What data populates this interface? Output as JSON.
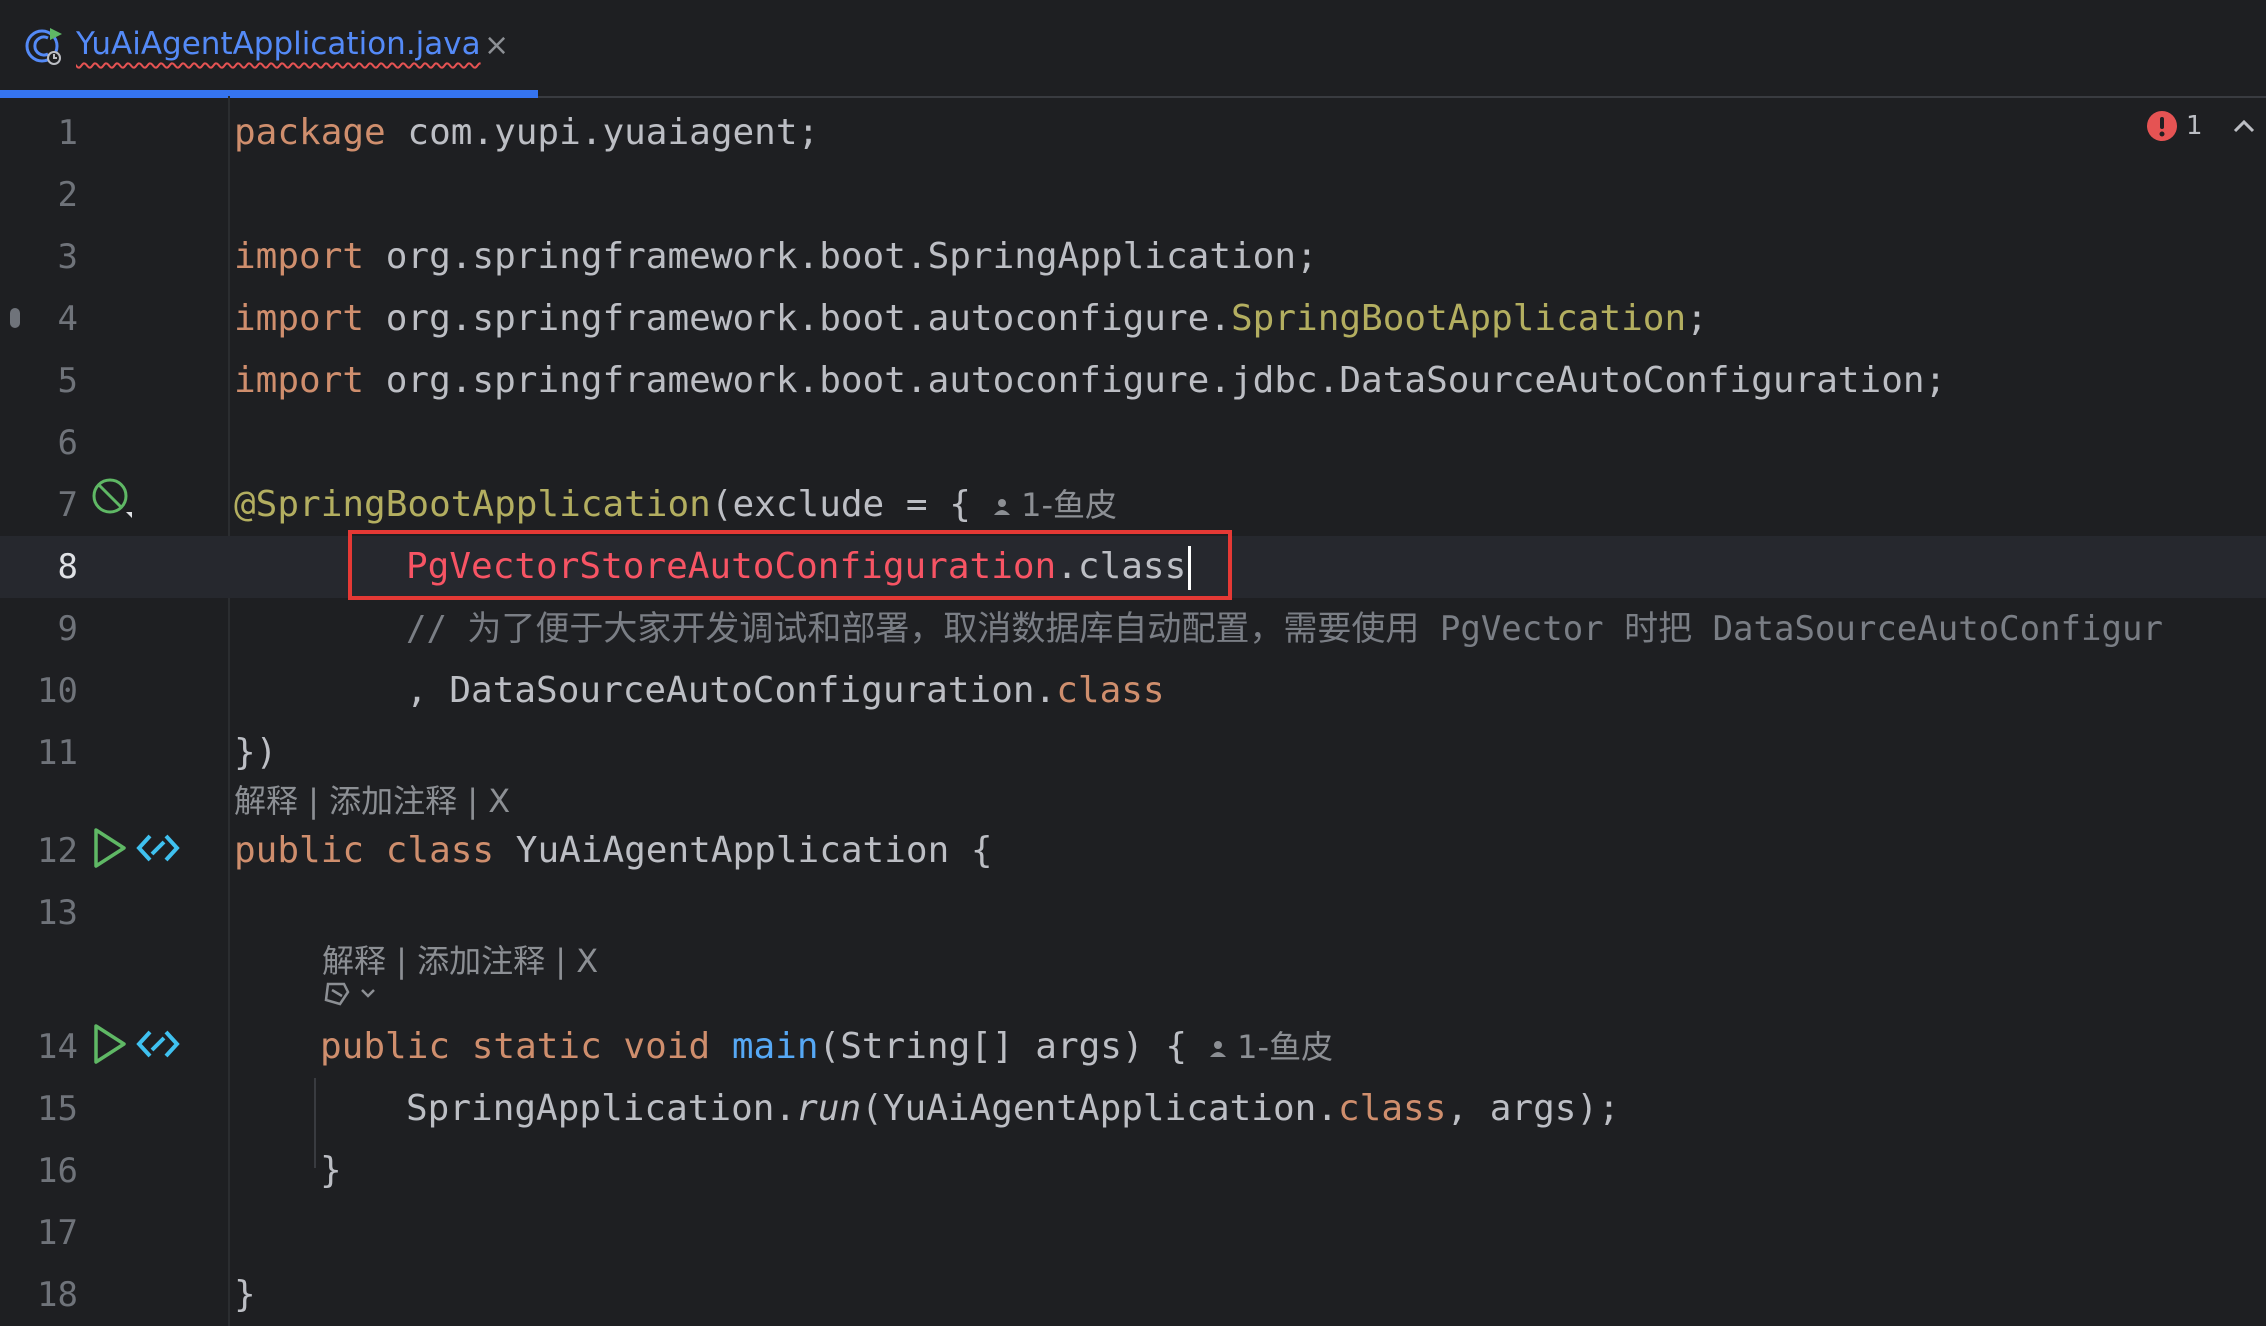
{
  "tab": {
    "title": "YuAiAgentApplication.java",
    "close": "×"
  },
  "problems": {
    "count": "1"
  },
  "hints": {
    "explain": "解释 | 添加注释 | X"
  },
  "author": "1-鱼皮",
  "lines": {
    "n1": "1",
    "n2": "2",
    "n3": "3",
    "n4": "4",
    "n5": "5",
    "n6": "6",
    "n7": "7",
    "n8": "8",
    "n9": "9",
    "n10": "10",
    "n11": "11",
    "n12": "12",
    "n13": "13",
    "n14": "14",
    "n15": "15",
    "n16": "16",
    "n17": "17",
    "n18": "18"
  },
  "code": {
    "l1_kw": "package",
    "l1_rest": " com.yupi.yuaiagent;",
    "l3_kw": "import",
    "l3_rest": " org.springframework.boot.SpringApplication;",
    "l4_kw": "import",
    "l4_pre": " org.springframework.boot.autoconfigure.",
    "l4_ann": "SpringBootApplication",
    "l4_post": ";",
    "l5_kw": "import",
    "l5_rest": " org.springframework.boot.autoconfigure.jdbc.DataSourceAutoConfiguration;",
    "l7_ann": "@SpringBootApplication",
    "l7_rest": "(exclude = {",
    "l8_err": "PgVectorStoreAutoConfiguration",
    "l8_rest": ".class",
    "l9_cmt": "// 为了便于大家开发调试和部署，取消数据库自动配置，需要使用 PgVector 时把 DataSourceAutoConfigur",
    "l10_pre": ", DataSourceAutoConfiguration.",
    "l10_kw": "class",
    "l11": "})",
    "l12_kw": "public class",
    "l12_rest": " YuAiAgentApplication {",
    "l14_kw": "public static void",
    "l14_fn": "main",
    "l14_rest": "(String[] args) {",
    "l15_pre": "SpringApplication.",
    "l15_it": "run",
    "l15_mid": "(YuAiAgentApplication.",
    "l15_kw": "class",
    "l15_post": ", args);",
    "l16": "}",
    "l18": "}"
  },
  "colors": {
    "keyword": "#cf8e6d",
    "annotation": "#b3ae60",
    "function": "#56a8f5",
    "error": "#f75464",
    "highlight_box": "#e53935"
  }
}
